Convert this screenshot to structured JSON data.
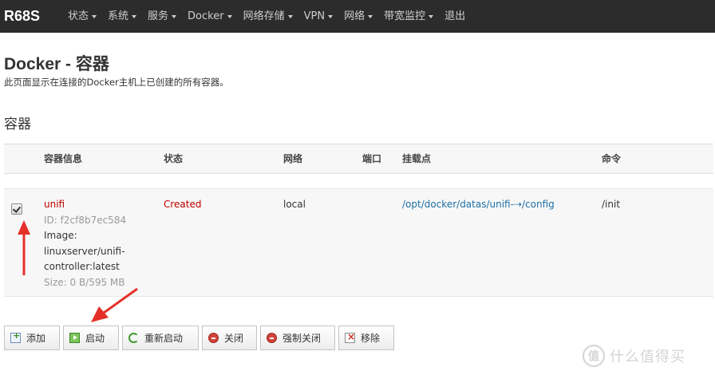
{
  "navbar": {
    "brand": "R68S",
    "menu": [
      {
        "label": "状态",
        "dropdown": true
      },
      {
        "label": "系统",
        "dropdown": true
      },
      {
        "label": "服务",
        "dropdown": true
      },
      {
        "label": "Docker",
        "dropdown": true
      },
      {
        "label": "网络存储",
        "dropdown": true
      },
      {
        "label": "VPN",
        "dropdown": true
      },
      {
        "label": "网络",
        "dropdown": true
      },
      {
        "label": "带宽监控",
        "dropdown": true
      },
      {
        "label": "退出",
        "dropdown": false
      }
    ]
  },
  "page": {
    "title": "Docker - 容器",
    "description": "此页面显示在连接的Docker主机上已创建的所有容器。",
    "section_title": "容器"
  },
  "table": {
    "columns": [
      "容器信息",
      "状态",
      "网络",
      "端口",
      "挂载点",
      "命令"
    ],
    "rows": [
      {
        "checked": true,
        "name": "unifi",
        "id": "ID: f2cf8b7ec584",
        "image_label": "Image:",
        "image_line1": "linuxserver/unifi-",
        "image_line2": "controller:latest",
        "size": "Size: 0 B/595 MB",
        "status": "Created",
        "network": "local",
        "ports": "",
        "mounts": "/opt/docker/datas/unifi-⇢/config",
        "command": "/init"
      }
    ]
  },
  "buttons": [
    {
      "label": "添加",
      "icon": "add-icon"
    },
    {
      "label": "启动",
      "icon": "start-icon"
    },
    {
      "label": "重新启动",
      "icon": "restart-icon"
    },
    {
      "label": "关闭",
      "icon": "stop-icon"
    },
    {
      "label": "强制关闭",
      "icon": "kill-icon"
    },
    {
      "label": "移除",
      "icon": "remove-icon"
    }
  ],
  "watermark": {
    "logo": "值",
    "text": "什么值得买"
  },
  "colors": {
    "navbar_bg": "#2c2c2c",
    "accent_red": "#c00000",
    "link_blue": "#1d6fa5",
    "arrow_red": "#e5302a"
  }
}
